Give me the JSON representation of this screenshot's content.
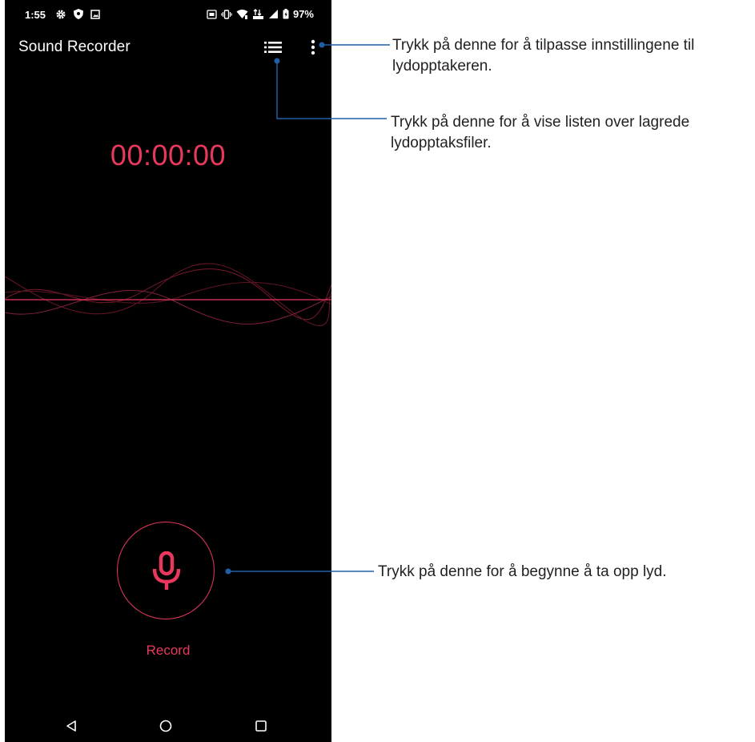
{
  "status_bar": {
    "time": "1:55",
    "battery": "97%",
    "left_icons": [
      "gear-icon",
      "shield-icon",
      "image-icon"
    ],
    "right_icons": [
      "nfc-icon",
      "vibrate-icon",
      "wifi-icon",
      "data-icon",
      "signal-icon",
      "battery-icon"
    ]
  },
  "app": {
    "title": "Sound Recorder",
    "timer": "00:00:00",
    "record_label": "Record",
    "accent_color": "#e8395d",
    "background": "#000000"
  },
  "toolbar": {
    "list_icon": "list-icon",
    "more_icon": "more-vertical-icon"
  },
  "nav_bar": {
    "back_icon": "back-triangle-icon",
    "home_icon": "home-circle-icon",
    "recents_icon": "recents-square-icon"
  },
  "callouts": {
    "settings": "Trykk på denne for å tilpasse innstillingene til lydopptakeren.",
    "list": "Trykk på denne for å vise listen over lagrede lydopptaksfiler.",
    "record": "Trykk på denne for å begynne å ta opp lyd.",
    "line_color": "#1f5fa8"
  }
}
